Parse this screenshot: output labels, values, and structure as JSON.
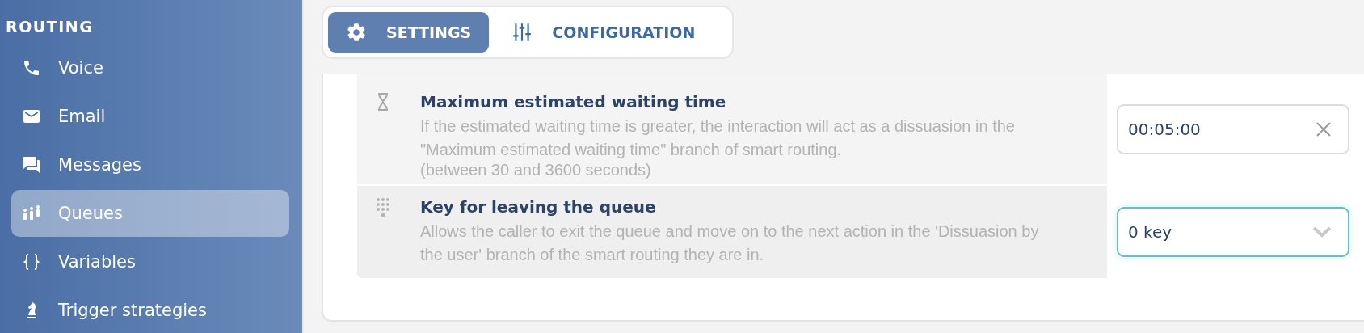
{
  "sidebar": {
    "section_title": "ROUTING",
    "items": [
      {
        "label": "Voice",
        "selected": false
      },
      {
        "label": "Email",
        "selected": false
      },
      {
        "label": "Messages",
        "selected": false
      },
      {
        "label": "Queues",
        "selected": true
      },
      {
        "label": "Variables",
        "selected": false
      },
      {
        "label": "Trigger strategies",
        "selected": false
      }
    ]
  },
  "tabs": [
    {
      "label": "SETTINGS",
      "selected": true
    },
    {
      "label": "CONFIGURATION",
      "selected": false
    }
  ],
  "settings": [
    {
      "kind": "time",
      "title": "Maximum estimated waiting time",
      "description": "If the estimated waiting time is greater, the interaction will act as a dissuasion in the \"Maximum estimated waiting time\" branch of smart routing.",
      "note": "(between 30 and 3600 seconds)",
      "value": "00:05:00",
      "focused": false
    },
    {
      "kind": "select",
      "title": "Key for leaving the queue",
      "description": "Allows the caller to exit the queue and move on to the next action in the 'Dissuasion by the user' branch of the smart routing they are in.",
      "value": "0 key",
      "focused": true
    }
  ]
}
